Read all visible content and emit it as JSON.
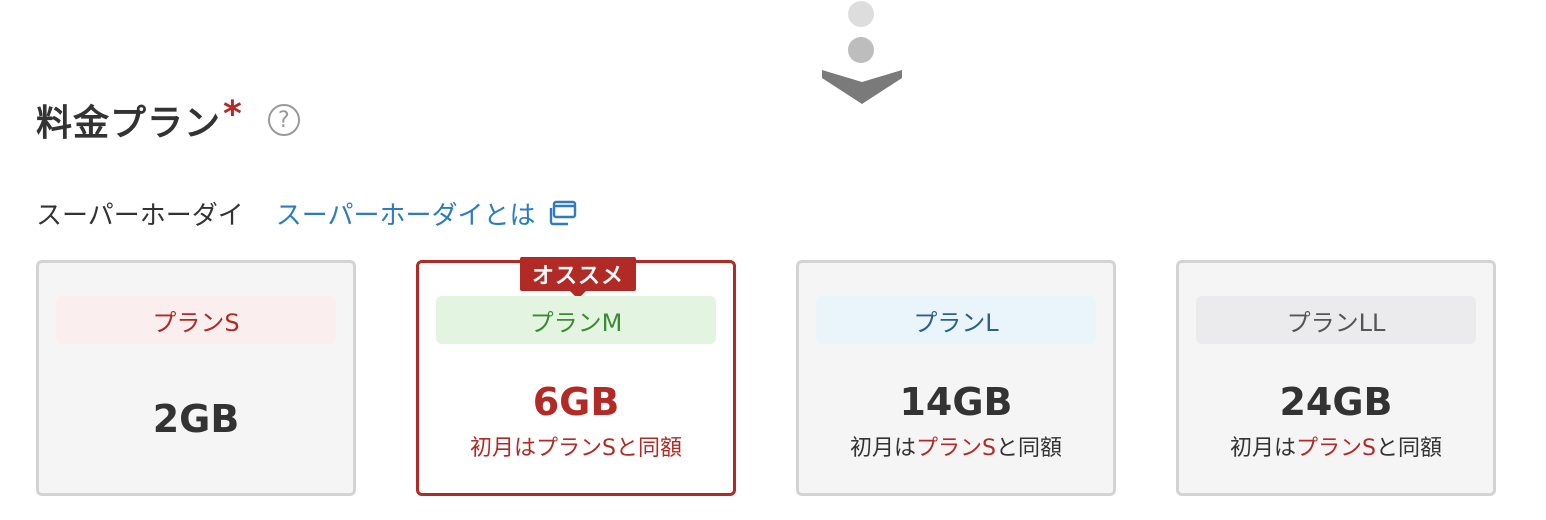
{
  "heading": {
    "title": "料金プラン",
    "required_mark": "*",
    "help_icon": "question-circle-icon"
  },
  "step_indicator": {
    "icon": "chevron-down-icon"
  },
  "sub": {
    "label": "スーパーホーダイ",
    "link_text": "スーパーホーダイとは",
    "link_icon": "external-window-icon"
  },
  "plans": [
    {
      "name": "プランS",
      "data": "2GB",
      "selected": false,
      "pill_color": "#fbeeee",
      "text_color": "#b22a25"
    },
    {
      "name": "プランM",
      "data": "6GB",
      "badge": "オススメ",
      "note_prefix": "初月は",
      "note_highlight": "プランS",
      "note_suffix": "と同額",
      "selected": true,
      "pill_color": "#e3f5e1",
      "text_color": "#3c8a35"
    },
    {
      "name": "プランL",
      "data": "14GB",
      "note_prefix": "初月は",
      "note_highlight": "プランS",
      "note_suffix": "と同額",
      "selected": false,
      "pill_color": "#eaf5fb",
      "text_color": "#2c5f8a"
    },
    {
      "name": "プランLL",
      "data": "24GB",
      "note_prefix": "初月は",
      "note_highlight": "プランS",
      "note_suffix": "と同額",
      "selected": false,
      "pill_color": "#ebebee",
      "text_color": "#555555"
    }
  ],
  "colors": {
    "accent_red": "#b22a25",
    "link_blue": "#2d7bc0",
    "card_border": "#d3d3d3",
    "card_bg": "#f5f5f5"
  }
}
